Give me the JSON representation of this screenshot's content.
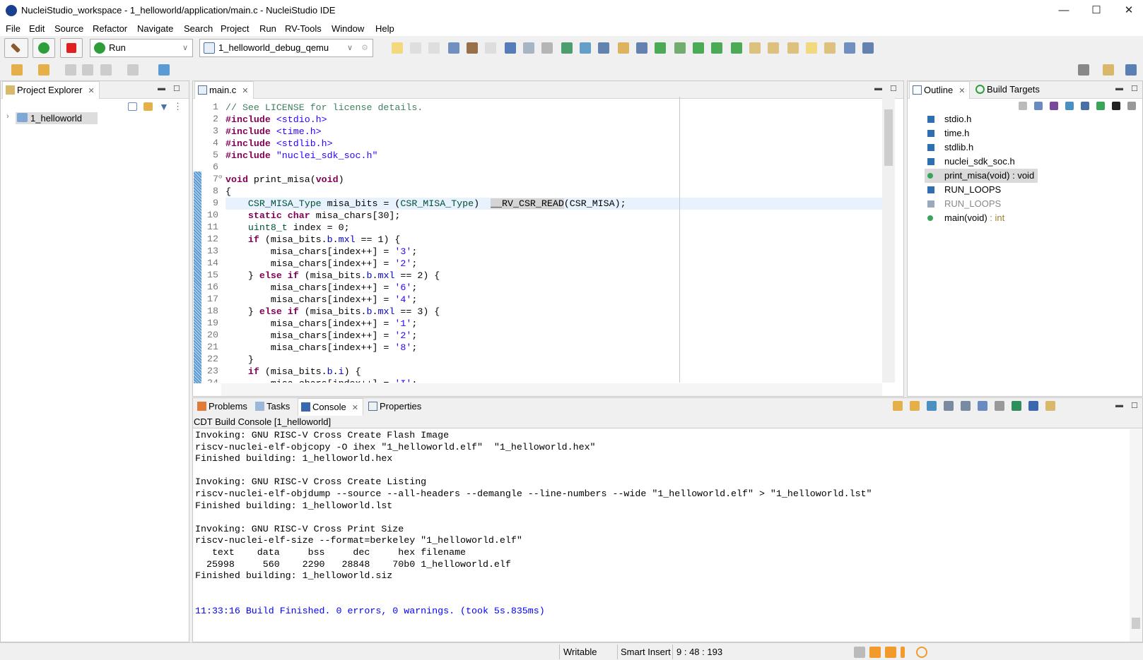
{
  "window": {
    "title": "NucleiStudio_workspace - 1_helloworld/application/main.c - NucleiStudio IDE",
    "minimize": "—",
    "maximize": "☐",
    "close": "✕"
  },
  "menu": [
    "File",
    "Edit",
    "Source",
    "Refactor",
    "Navigate",
    "Search",
    "Project",
    "Run",
    "RV-Tools",
    "Window",
    "Help"
  ],
  "toolbar": {
    "run_mode": "Run",
    "launch_config": "1_helloworld_debug_qemu"
  },
  "project_explorer": {
    "tab": "Project Explorer",
    "items": [
      {
        "label": "1_helloworld",
        "expanded": false
      }
    ]
  },
  "editor": {
    "tab": "main.c",
    "cursor_line": 9,
    "lines": [
      [
        [
          "// See LICENSE for license details.",
          "cm"
        ]
      ],
      [
        [
          "#include",
          "kw"
        ],
        [
          " ",
          ""
        ],
        [
          "<stdio.h>",
          "st"
        ]
      ],
      [
        [
          "#include",
          "kw"
        ],
        [
          " ",
          ""
        ],
        [
          "<time.h>",
          "st"
        ]
      ],
      [
        [
          "#include",
          "kw"
        ],
        [
          " ",
          ""
        ],
        [
          "<stdlib.h>",
          "st"
        ]
      ],
      [
        [
          "#include",
          "kw"
        ],
        [
          " ",
          ""
        ],
        [
          "\"nuclei_sdk_soc.h\"",
          "st"
        ]
      ],
      [],
      [
        [
          "void",
          "kw"
        ],
        [
          " print_misa(",
          ""
        ],
        [
          "void",
          "kw"
        ],
        [
          ")",
          ""
        ]
      ],
      [
        [
          "{",
          ""
        ]
      ],
      [
        [
          "    ",
          ""
        ],
        [
          "CSR_MISA_Type",
          "ty"
        ],
        [
          " misa_bits = (",
          ""
        ],
        [
          "CSR_MISA_Type",
          "ty"
        ],
        [
          ")  ",
          ""
        ],
        [
          "__RV_CSR_READ",
          "mc"
        ],
        [
          "(CSR_MISA);",
          ""
        ]
      ],
      [
        [
          "    ",
          ""
        ],
        [
          "static",
          "kw"
        ],
        [
          " ",
          ""
        ],
        [
          "char",
          "kw"
        ],
        [
          " misa_chars[30];",
          ""
        ]
      ],
      [
        [
          "    ",
          ""
        ],
        [
          "uint8_t",
          "ty"
        ],
        [
          " index = 0;",
          ""
        ]
      ],
      [
        [
          "    ",
          ""
        ],
        [
          "if",
          "kw"
        ],
        [
          " (misa_bits.",
          ""
        ],
        [
          "b",
          "fd"
        ],
        [
          ".",
          ""
        ],
        [
          "mxl",
          "fd"
        ],
        [
          " == 1) {",
          ""
        ]
      ],
      [
        [
          "        misa_chars[index++] = ",
          ""
        ],
        [
          "'3'",
          "st"
        ],
        [
          ";",
          ""
        ]
      ],
      [
        [
          "        misa_chars[index++] = ",
          ""
        ],
        [
          "'2'",
          "st"
        ],
        [
          ";",
          ""
        ]
      ],
      [
        [
          "    } ",
          ""
        ],
        [
          "else",
          "kw"
        ],
        [
          " ",
          ""
        ],
        [
          "if",
          "kw"
        ],
        [
          " (misa_bits.",
          ""
        ],
        [
          "b",
          "fd"
        ],
        [
          ".",
          ""
        ],
        [
          "mxl",
          "fd"
        ],
        [
          " == 2) {",
          ""
        ]
      ],
      [
        [
          "        misa_chars[index++] = ",
          ""
        ],
        [
          "'6'",
          "st"
        ],
        [
          ";",
          ""
        ]
      ],
      [
        [
          "        misa_chars[index++] = ",
          ""
        ],
        [
          "'4'",
          "st"
        ],
        [
          ";",
          ""
        ]
      ],
      [
        [
          "    } ",
          ""
        ],
        [
          "else",
          "kw"
        ],
        [
          " ",
          ""
        ],
        [
          "if",
          "kw"
        ],
        [
          " (misa_bits.",
          ""
        ],
        [
          "b",
          "fd"
        ],
        [
          ".",
          ""
        ],
        [
          "mxl",
          "fd"
        ],
        [
          " == 3) {",
          ""
        ]
      ],
      [
        [
          "        misa_chars[index++] = ",
          ""
        ],
        [
          "'1'",
          "st"
        ],
        [
          ";",
          ""
        ]
      ],
      [
        [
          "        misa_chars[index++] = ",
          ""
        ],
        [
          "'2'",
          "st"
        ],
        [
          ";",
          ""
        ]
      ],
      [
        [
          "        misa_chars[index++] = ",
          ""
        ],
        [
          "'8'",
          "st"
        ],
        [
          ";",
          ""
        ]
      ],
      [
        [
          "    }",
          ""
        ]
      ],
      [
        [
          "    ",
          ""
        ],
        [
          "if",
          "kw"
        ],
        [
          " (misa_bits.",
          ""
        ],
        [
          "b",
          "fd"
        ],
        [
          ".",
          ""
        ],
        [
          "i",
          "fd"
        ],
        [
          ") {",
          ""
        ]
      ],
      [
        [
          "        misa_chars[index++] = ",
          ""
        ],
        [
          "'I'",
          "st"
        ],
        [
          ";",
          ""
        ]
      ]
    ]
  },
  "outline": {
    "tabs": [
      "Outline",
      "Build Targets"
    ],
    "items": [
      {
        "label": "stdio.h",
        "kind": "include"
      },
      {
        "label": "time.h",
        "kind": "include"
      },
      {
        "label": "stdlib.h",
        "kind": "include"
      },
      {
        "label": "nuclei_sdk_soc.h",
        "kind": "include"
      },
      {
        "label": "print_misa(void)",
        "type": " : void",
        "kind": "function",
        "selected": true
      },
      {
        "label": "RUN_LOOPS",
        "kind": "macro"
      },
      {
        "label": "RUN_LOOPS",
        "kind": "macro-inactive"
      },
      {
        "label": "main(void)",
        "type": " : int",
        "kind": "function"
      }
    ]
  },
  "bottom": {
    "tabs": [
      "Problems",
      "Tasks",
      "Console",
      "Properties"
    ],
    "active": "Console",
    "console_title": "CDT Build Console [1_helloworld]",
    "lines": [
      "Invoking: GNU RISC-V Cross Create Flash Image",
      "riscv-nuclei-elf-objcopy -O ihex \"1_helloworld.elf\"  \"1_helloworld.hex\"",
      "Finished building: 1_helloworld.hex",
      "",
      "Invoking: GNU RISC-V Cross Create Listing",
      "riscv-nuclei-elf-objdump --source --all-headers --demangle --line-numbers --wide \"1_helloworld.elf\" > \"1_helloworld.lst\"",
      "Finished building: 1_helloworld.lst",
      "",
      "Invoking: GNU RISC-V Cross Print Size",
      "riscv-nuclei-elf-size --format=berkeley \"1_helloworld.elf\"",
      "   text\t   data\t    bss\t    dec\t    hex\tfilename",
      "  25998\t    560\t   2290\t  28848\t   70b0\t1_helloworld.elf",
      "Finished building: 1_helloworld.siz",
      "",
      "",
      ""
    ],
    "final_line": "11:33:16 Build Finished. 0 errors, 0 warnings. (took 5s.835ms)",
    "final_color": "#0000ff"
  },
  "status": {
    "writable": "Writable",
    "insert_mode": "Smart Insert",
    "position": "9 : 48 : 193"
  },
  "colors": {
    "keyword": "#7f0055",
    "string": "#2a00ff",
    "comment": "#3f7f5f",
    "type": "#005032",
    "field": "#0000c0",
    "current_line": "#e8f2fe",
    "run_green": "#2e9e3a",
    "stop_red": "#e02020"
  }
}
